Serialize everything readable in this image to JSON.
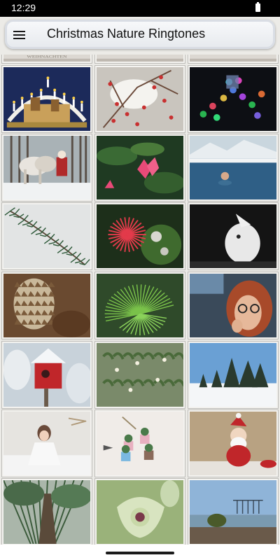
{
  "status_bar": {
    "time": "12:29"
  },
  "app_bar": {
    "title": "Christmas Nature Ringtones",
    "menu_icon": "hamburger-menu-icon"
  },
  "grid": {
    "tiles": [
      {
        "name": "tile-partial-weihnachten",
        "subject": "partial",
        "caption": "WEIHNACHTEN"
      },
      {
        "name": "tile-partial-2",
        "subject": "partial"
      },
      {
        "name": "tile-partial-3",
        "subject": "partial"
      },
      {
        "name": "tile-candle-arch",
        "subject": "candle-arch"
      },
      {
        "name": "tile-snowy-berries",
        "subject": "snowy-berries"
      },
      {
        "name": "tile-bokeh-lights",
        "subject": "bokeh-lights"
      },
      {
        "name": "tile-horse-sleigh",
        "subject": "horse-sleigh"
      },
      {
        "name": "tile-pink-flower",
        "subject": "pink-flower"
      },
      {
        "name": "tile-ice-swimmer",
        "subject": "ice-swimmer"
      },
      {
        "name": "tile-snowy-branch",
        "subject": "snowy-branch"
      },
      {
        "name": "tile-red-bloom",
        "subject": "red-bloom"
      },
      {
        "name": "tile-white-figure",
        "subject": "white-figure"
      },
      {
        "name": "tile-pine-cones",
        "subject": "pine-cones"
      },
      {
        "name": "tile-pine-needles",
        "subject": "pine-needles"
      },
      {
        "name": "tile-woman-glasses",
        "subject": "woman-glasses"
      },
      {
        "name": "tile-red-birdhouse",
        "subject": "red-birdhouse"
      },
      {
        "name": "tile-mistletoe",
        "subject": "mistletoe"
      },
      {
        "name": "tile-snowy-trees",
        "subject": "snowy-trees"
      },
      {
        "name": "tile-girl-in-snow",
        "subject": "girl-in-snow"
      },
      {
        "name": "tile-succulent-pots",
        "subject": "succulent-pots"
      },
      {
        "name": "tile-santa-figurine",
        "subject": "santa-figurine"
      },
      {
        "name": "tile-tree-trunk",
        "subject": "tree-trunk"
      },
      {
        "name": "tile-hellebore",
        "subject": "hellebore"
      },
      {
        "name": "tile-harbor",
        "subject": "harbor"
      }
    ]
  }
}
